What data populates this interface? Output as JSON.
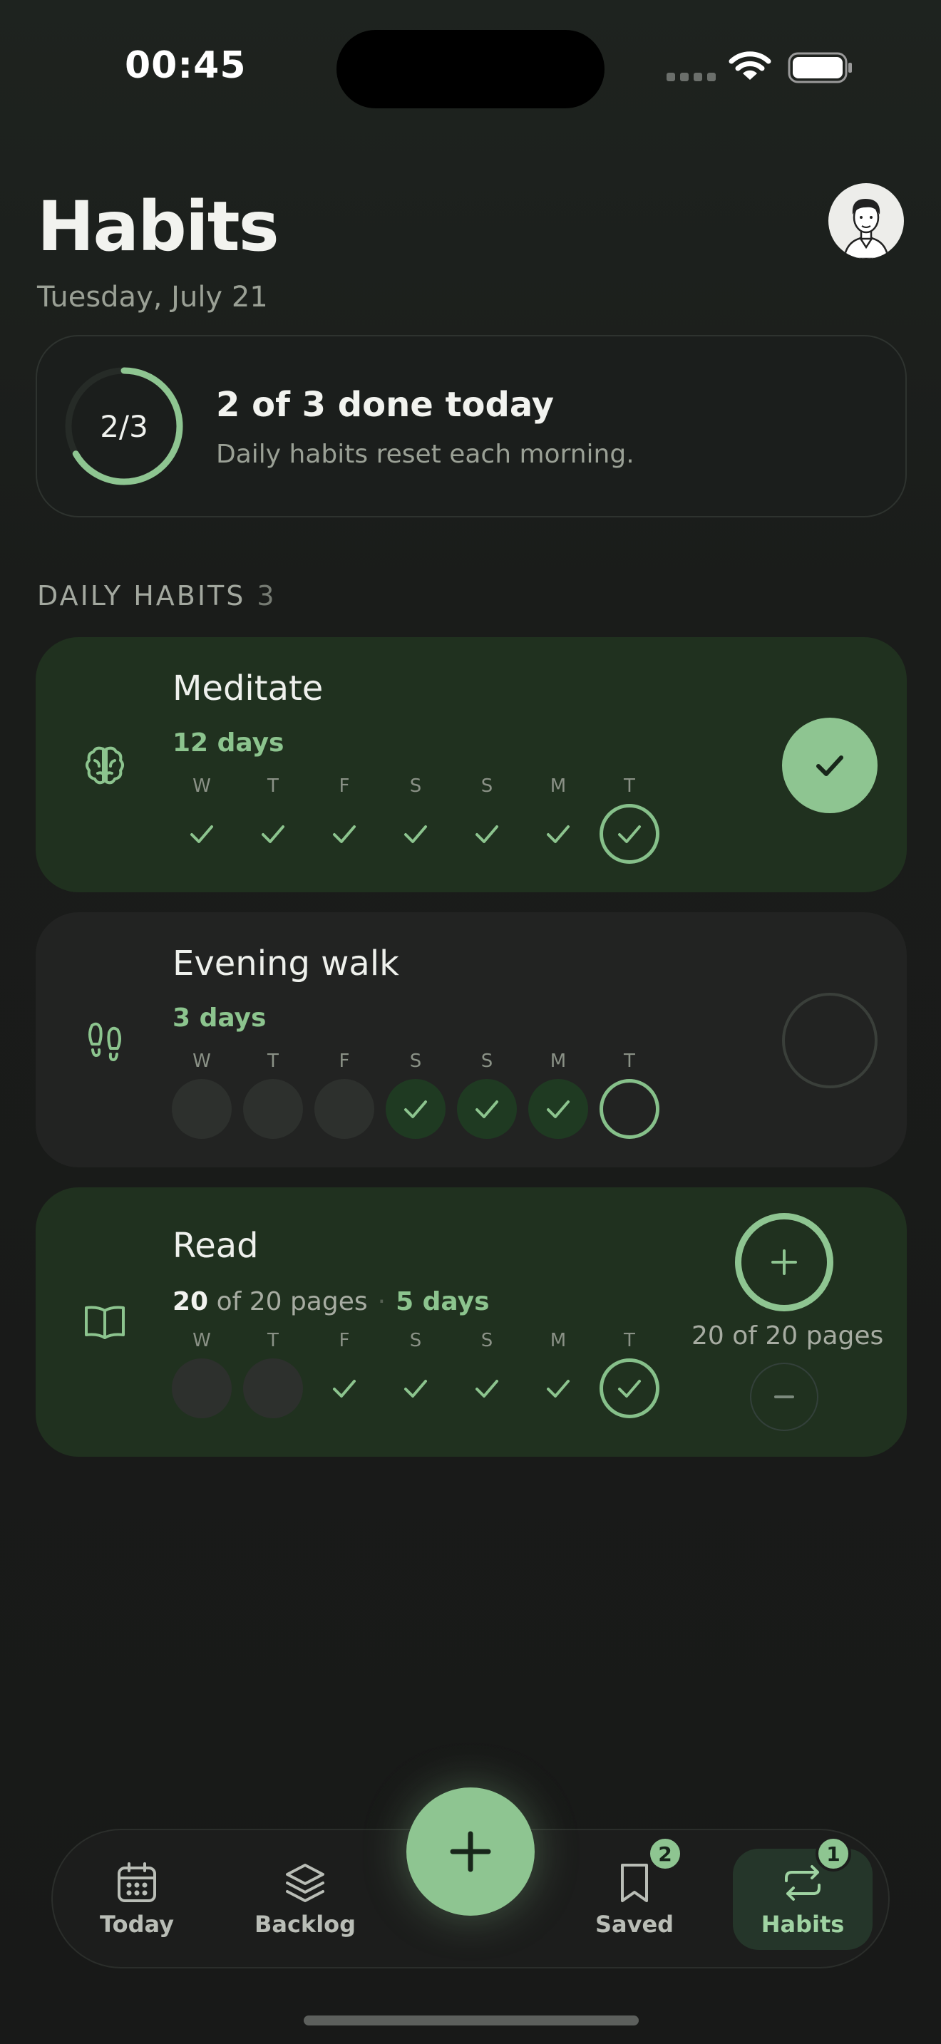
{
  "status_bar": {
    "time": "00:45"
  },
  "header": {
    "title": "Habits",
    "date": "Tuesday, July 21"
  },
  "summary": {
    "ring_label": "2/3",
    "title": "2 of 3 done today",
    "subtitle": "Daily habits reset each morning.",
    "progress": 0.667
  },
  "section": {
    "label": "DAILY HABITS",
    "count": "3"
  },
  "habits": [
    {
      "name": "Meditate",
      "icon": "brain-icon",
      "streak": "12 days",
      "status": "done",
      "days": [
        {
          "label": "W",
          "state": "check"
        },
        {
          "label": "T",
          "state": "check"
        },
        {
          "label": "F",
          "state": "check"
        },
        {
          "label": "S",
          "state": "check"
        },
        {
          "label": "S",
          "state": "check"
        },
        {
          "label": "M",
          "state": "check"
        },
        {
          "label": "T",
          "state": "today-check"
        }
      ]
    },
    {
      "name": "Evening walk",
      "icon": "footprints-icon",
      "streak": "3 days",
      "status": "todo",
      "days": [
        {
          "label": "W",
          "state": "empty"
        },
        {
          "label": "T",
          "state": "empty"
        },
        {
          "label": "F",
          "state": "empty"
        },
        {
          "label": "S",
          "state": "fill-check"
        },
        {
          "label": "S",
          "state": "fill-check"
        },
        {
          "label": "M",
          "state": "fill-check"
        },
        {
          "label": "T",
          "state": "today-empty"
        }
      ]
    },
    {
      "name": "Read",
      "icon": "book-icon",
      "status": "done",
      "progress_current": "20",
      "progress_rest": "of 20 pages",
      "streak": "5 days",
      "pages_label": "20 of 20 pages",
      "days": [
        {
          "label": "W",
          "state": "empty"
        },
        {
          "label": "T",
          "state": "empty"
        },
        {
          "label": "F",
          "state": "check"
        },
        {
          "label": "S",
          "state": "check"
        },
        {
          "label": "S",
          "state": "check"
        },
        {
          "label": "M",
          "state": "check"
        },
        {
          "label": "T",
          "state": "today-check"
        }
      ]
    }
  ],
  "tabbar": {
    "tabs": [
      {
        "label": "Today",
        "icon": "calendar-icon"
      },
      {
        "label": "Backlog",
        "icon": "layers-icon"
      },
      {
        "label": "Saved",
        "icon": "bookmark-icon",
        "badge": "2"
      },
      {
        "label": "Habits",
        "icon": "repeat-icon",
        "badge": "1",
        "active": true
      }
    ]
  },
  "colors": {
    "accent": "#8ec591",
    "done_card": "#20311f",
    "todo_card": "#222322",
    "background": "#181918"
  }
}
